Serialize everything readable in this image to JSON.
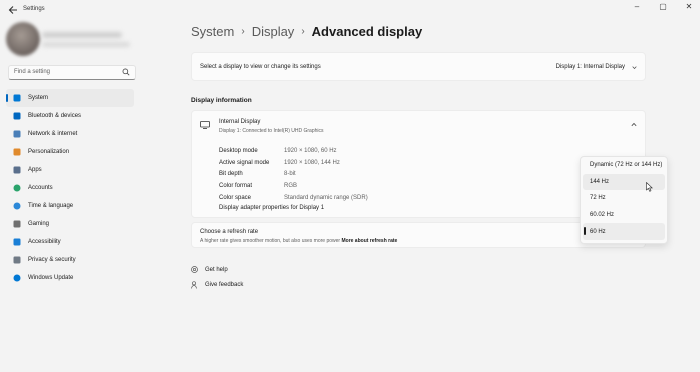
{
  "window": {
    "title": "Settings"
  },
  "sidebar": {
    "search_placeholder": "Find a setting",
    "items": [
      {
        "label": "System",
        "icon": "system-icon",
        "color": "#0078d4"
      },
      {
        "label": "Bluetooth & devices",
        "icon": "bluetooth-icon",
        "color": "#0067c0"
      },
      {
        "label": "Network & internet",
        "icon": "network-icon",
        "color": "#4a7fb8"
      },
      {
        "label": "Personalization",
        "icon": "brush-icon",
        "color": "#e08a2c"
      },
      {
        "label": "Apps",
        "icon": "apps-icon",
        "color": "#5a6f8c"
      },
      {
        "label": "Accounts",
        "icon": "accounts-icon",
        "color": "#2aa36b"
      },
      {
        "label": "Time & language",
        "icon": "globe-icon",
        "color": "#2b88d8"
      },
      {
        "label": "Gaming",
        "icon": "gaming-icon",
        "color": "#707070"
      },
      {
        "label": "Accessibility",
        "icon": "accessibility-icon",
        "color": "#1a7fd6"
      },
      {
        "label": "Privacy & security",
        "icon": "shield-icon",
        "color": "#707a85"
      },
      {
        "label": "Windows Update",
        "icon": "update-icon",
        "color": "#0078d4"
      }
    ]
  },
  "breadcrumb": {
    "level1": "System",
    "level2": "Display",
    "current": "Advanced display"
  },
  "select_display": {
    "prompt": "Select a display to view or change its settings",
    "value": "Display 1: Internal Display"
  },
  "display_info": {
    "heading": "Display information",
    "name": "Internal Display",
    "subtitle": "Display 1: Connected to Intel(R) UHD Graphics",
    "rows": [
      {
        "key": "Desktop mode",
        "value": "1920 × 1080, 60 Hz"
      },
      {
        "key": "Active signal mode",
        "value": "1920 × 1080, 144 Hz"
      },
      {
        "key": "Bit depth",
        "value": "8-bit"
      },
      {
        "key": "Color format",
        "value": "RGB"
      },
      {
        "key": "Color space",
        "value": "Standard dynamic range (SDR)"
      }
    ],
    "adapter_link": "Display adapter properties for Display 1"
  },
  "refresh": {
    "title": "Choose a refresh rate",
    "description": "A higher rate gives smoother motion, but also uses more power",
    "link": "More about refresh rate",
    "options": [
      "Dynamic (72 Hz or 144 Hz)",
      "144 Hz",
      "72 Hz",
      "60.02 Hz",
      "60 Hz"
    ],
    "selected": "60 Hz",
    "hovered": "144 Hz"
  },
  "help": {
    "get_help": "Get help",
    "feedback": "Give feedback"
  },
  "colors": {
    "accent": "#0067c0",
    "background": "#f3f3f3",
    "card": "#fbfbfb"
  }
}
